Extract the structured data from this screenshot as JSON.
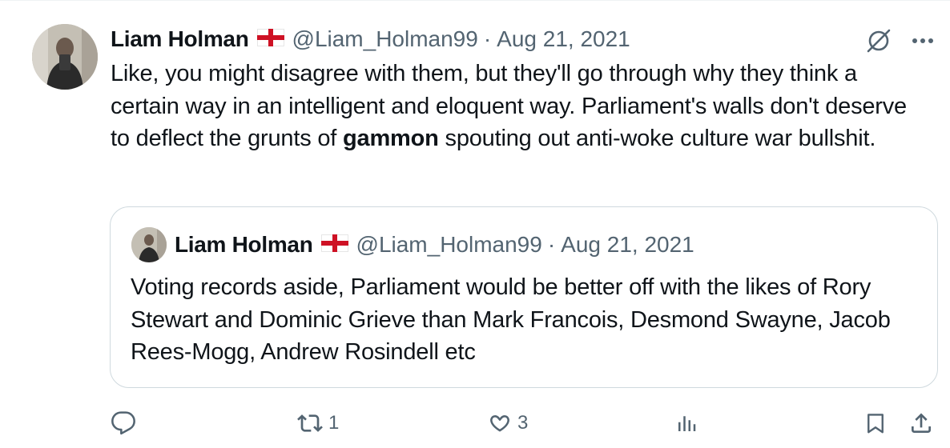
{
  "tweet": {
    "author_name": "Liam Holman",
    "flag_icon": "england-flag-icon",
    "handle": "@Liam_Holman99",
    "separator": "·",
    "date": "Aug 21, 2021",
    "text_before": "Like, you might disagree with them, but they'll go through why they think a certain way in an intelligent and eloquent way. Parliament's walls don't deserve to deflect the grunts of ",
    "text_bold": "gammon",
    "text_after": " spouting out anti-woke culture war bullshit."
  },
  "quoted_tweet": {
    "author_name": "Liam Holman",
    "handle": "@Liam_Holman99",
    "separator": "·",
    "date": "Aug 21, 2021",
    "text": "Voting records aside, Parliament would be better off with the likes of Rory Stewart and Dominic Grieve than Mark Francois, Desmond Swayne, Jacob Rees-Mogg, Andrew Rosindell etc"
  },
  "actions": {
    "reply": {
      "icon": "reply-icon",
      "count": ""
    },
    "retweet": {
      "icon": "retweet-icon",
      "count": "1"
    },
    "like": {
      "icon": "heart-icon",
      "count": "3"
    },
    "views": {
      "icon": "views-icon",
      "count": ""
    },
    "bookmark": {
      "icon": "bookmark-icon"
    },
    "share": {
      "icon": "share-icon"
    }
  },
  "colors": {
    "text": "#0f1419",
    "secondary": "#536471",
    "border": "#cfd9de",
    "flag_red": "#ce1124"
  }
}
